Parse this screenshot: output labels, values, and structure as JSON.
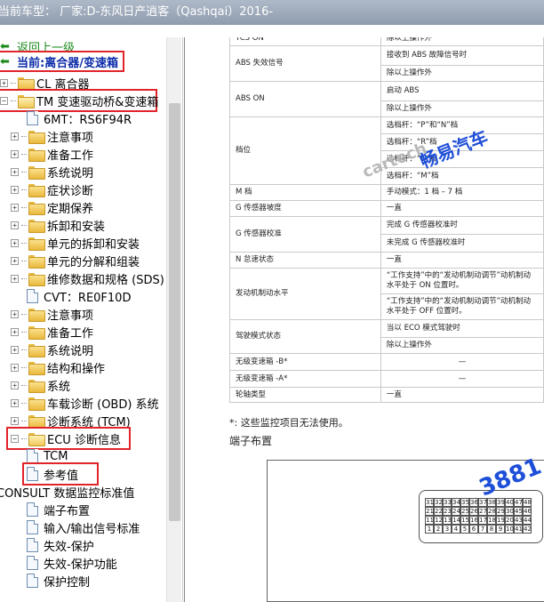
{
  "window": {
    "title": "当前车型： 厂家:D-东风日产逍客（Qashqai）2016-"
  },
  "sidebar": {
    "back_label": "返回上一级",
    "current_label": "当前:离合器/变速箱",
    "items": [
      {
        "label": "CL 离合器",
        "type": "folder"
      },
      {
        "label": "TM 变速驱动桥&变速箱",
        "type": "folder-open"
      },
      {
        "label": "6MT：RS6F94R",
        "type": "doc"
      },
      {
        "label": "注意事项",
        "type": "folder"
      },
      {
        "label": "准备工作",
        "type": "folder"
      },
      {
        "label": "系统说明",
        "type": "folder"
      },
      {
        "label": "症状诊断",
        "type": "folder"
      },
      {
        "label": "定期保养",
        "type": "folder"
      },
      {
        "label": "拆卸和安装",
        "type": "folder"
      },
      {
        "label": "单元的拆卸和安装",
        "type": "folder"
      },
      {
        "label": "单元的分解和组装",
        "type": "folder"
      },
      {
        "label": "维修数据和规格 (SDS)",
        "type": "folder"
      },
      {
        "label": "CVT：RE0F10D",
        "type": "doc"
      },
      {
        "label": "注意事项",
        "type": "folder"
      },
      {
        "label": "准备工作",
        "type": "folder"
      },
      {
        "label": "系统说明",
        "type": "folder"
      },
      {
        "label": "结构和操作",
        "type": "folder"
      },
      {
        "label": "系统",
        "type": "folder"
      },
      {
        "label": "车载诊断 (OBD) 系统",
        "type": "folder"
      },
      {
        "label": "诊断系统 (TCM)",
        "type": "folder"
      },
      {
        "label": "ECU 诊断信息",
        "type": "folder-open"
      },
      {
        "label": "TCM",
        "type": "doc"
      },
      {
        "label": "参考值",
        "type": "doc"
      },
      {
        "label": "CONSULT 数据监控标准值",
        "type": "text"
      },
      {
        "label": "端子布置",
        "type": "doc"
      },
      {
        "label": "输入/输出信号标准",
        "type": "doc"
      },
      {
        "label": "失效-保护",
        "type": "doc"
      },
      {
        "label": "失效-保护功能",
        "type": "doc"
      },
      {
        "label": "保护控制",
        "type": "doc"
      }
    ]
  },
  "table": {
    "rows": [
      {
        "item": "TCS ON",
        "cond": "除以上操作外"
      },
      {
        "item": "ABS 失效信号",
        "cond": "接收到 ABS 故障信号时"
      },
      {
        "item": "",
        "cond": "除以上操作外"
      },
      {
        "item": "ABS ON",
        "cond": "启动 ABS"
      },
      {
        "item": "",
        "cond": "除以上操作外"
      },
      {
        "item": "档位",
        "cond": "选档杆：“P”和“N”档"
      },
      {
        "item": "",
        "cond": "选档杆：“R”档"
      },
      {
        "item": "",
        "cond": "选档杆：“D”档"
      },
      {
        "item": "",
        "cond": "选档杆：“M”档"
      },
      {
        "item": "M 档",
        "cond": "手动模式：1 档 – 7 档"
      },
      {
        "item": "G 传感器坡度",
        "cond": "一直"
      },
      {
        "item": "G 传感器校准",
        "cond": "完成 G 传感器校准时"
      },
      {
        "item": "",
        "cond": "未完成 G 传感器校准时"
      },
      {
        "item": "N 怠速状态",
        "cond": "一直"
      },
      {
        "item": "发动机制动水平",
        "cond": "“工作支持”中的“发动机制动调节”动机制动水平处于 ON 位置时。"
      },
      {
        "item": "",
        "cond": "“工作支持”中的“发动机制动调节”动机制动水平处于 OFF 位置时。"
      },
      {
        "item": "驾驶模式状态",
        "cond": "当以 ECO 模式驾驶时"
      },
      {
        "item": "",
        "cond": "除以上操作外"
      },
      {
        "item": "无级变速箱 -B*",
        "cond": "—"
      },
      {
        "item": "无级变速箱 -A*",
        "cond": "—"
      },
      {
        "item": "轮轴类型",
        "cond": "一直"
      }
    ]
  },
  "note": "*: 这些监控项目无法使用。",
  "terminal": {
    "title": "端子布置",
    "pins_row1": [
      "31",
      "32",
      "33",
      "34",
      "35",
      "36",
      "37",
      "38",
      "39",
      "40",
      "47",
      "48"
    ],
    "pins_row2": [
      "21",
      "22",
      "23",
      "24",
      "25",
      "26",
      "27",
      "28",
      "29",
      "30",
      "45",
      "46"
    ],
    "pins_row3": [
      "11",
      "12",
      "13",
      "14",
      "15",
      "16",
      "17",
      "18",
      "19",
      "20",
      "43",
      "44"
    ],
    "pins_row4": [
      "1",
      "2",
      "3",
      "4",
      "5",
      "6",
      "7",
      "8",
      "9",
      "10",
      "41",
      "42"
    ]
  },
  "watermarks": {
    "brand": "畅易汽车",
    "number": "3881",
    "site": "cartech"
  }
}
